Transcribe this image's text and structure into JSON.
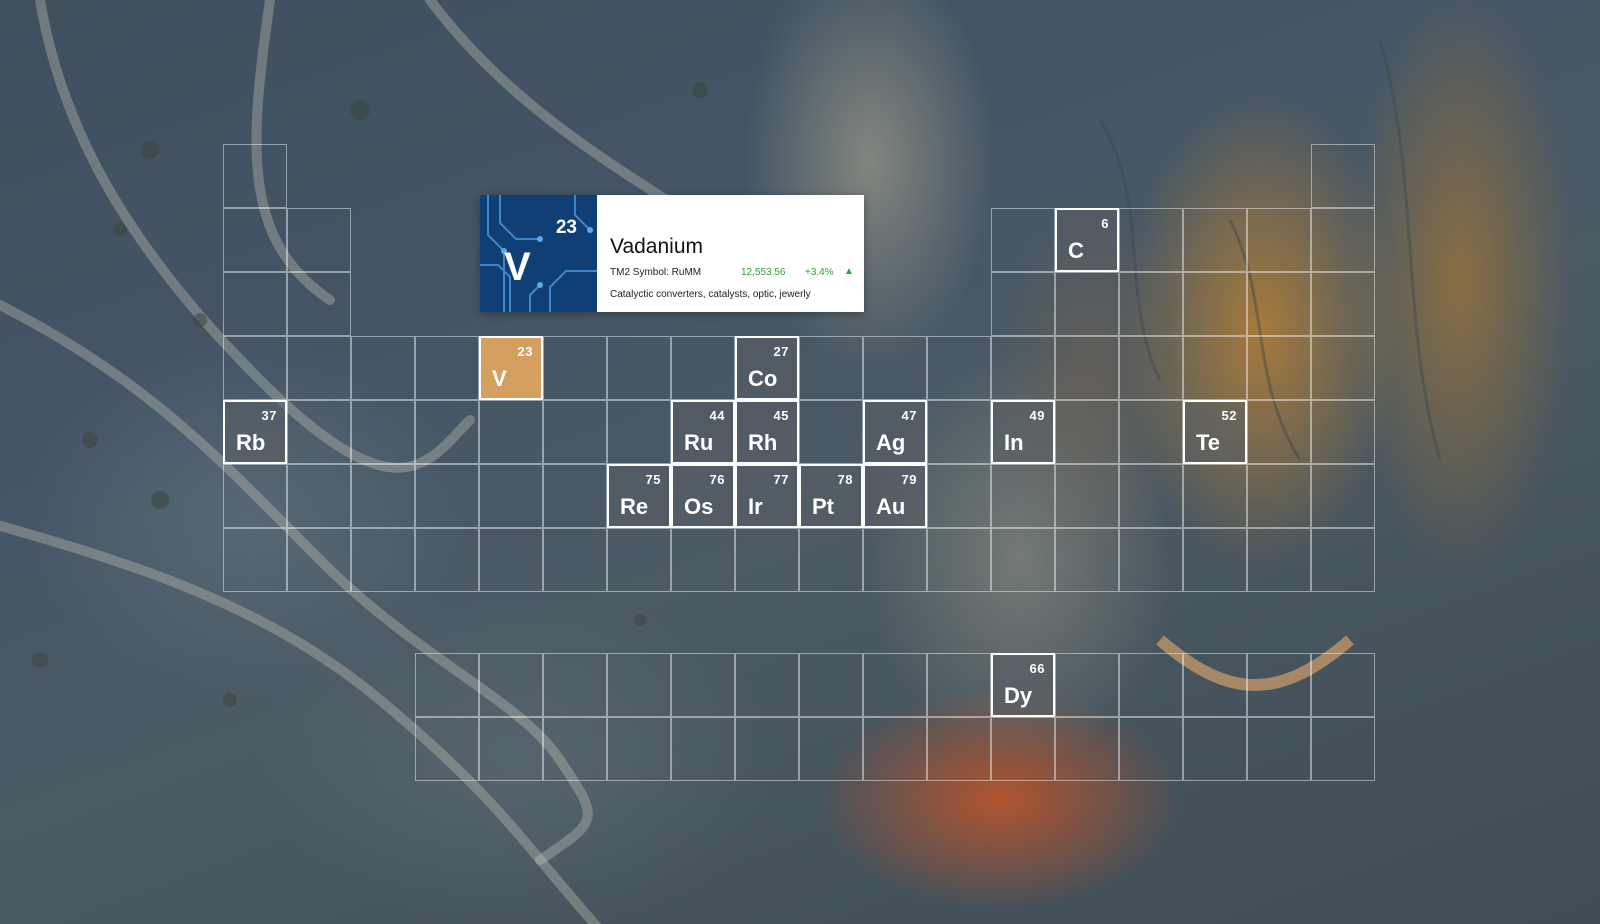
{
  "selected": {
    "number": "23",
    "symbol": "V",
    "name": "Vadanium",
    "tm2_label": "TM2 Symbol: RuMM",
    "price": "12,553.56",
    "change": "+3.4%",
    "trend_icon": "triangle-up-icon",
    "uses": "Catalyctic converters, catalysts, optic, jewerly",
    "trend_color": "#2fa33a"
  },
  "elements": [
    {
      "id": "c",
      "number": "6",
      "symbol": "C"
    },
    {
      "id": "v",
      "number": "23",
      "symbol": "V",
      "active": true
    },
    {
      "id": "co",
      "number": "27",
      "symbol": "Co"
    },
    {
      "id": "rb",
      "number": "37",
      "symbol": "Rb"
    },
    {
      "id": "ru",
      "number": "44",
      "symbol": "Ru"
    },
    {
      "id": "rh",
      "number": "45",
      "symbol": "Rh"
    },
    {
      "id": "ag",
      "number": "47",
      "symbol": "Ag"
    },
    {
      "id": "in",
      "number": "49",
      "symbol": "In"
    },
    {
      "id": "te",
      "number": "52",
      "symbol": "Te"
    },
    {
      "id": "re",
      "number": "75",
      "symbol": "Re"
    },
    {
      "id": "os",
      "number": "76",
      "symbol": "Os"
    },
    {
      "id": "ir",
      "number": "77",
      "symbol": "Ir"
    },
    {
      "id": "pt",
      "number": "78",
      "symbol": "Pt"
    },
    {
      "id": "au",
      "number": "79",
      "symbol": "Au"
    },
    {
      "id": "dy",
      "number": "66",
      "symbol": "Dy"
    }
  ],
  "colors": {
    "active": "#d4a060",
    "grid_line": "rgba(255,255,255,0.45)",
    "highlight_border": "#ffffff"
  },
  "background": "aerial-river-landscape"
}
